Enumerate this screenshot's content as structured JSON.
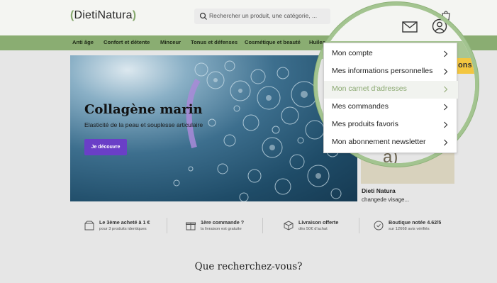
{
  "header": {
    "logo_open": "(",
    "logo_text": "DietiNatura",
    "logo_close": ")",
    "search_placeholder": "Rechercher un produit, une catégorie, ..."
  },
  "nav": {
    "items": [
      "Anti âge",
      "Confort et détente",
      "Minceur",
      "Tonus et défenses",
      "Cosmétique et beauté",
      "Huiles"
    ]
  },
  "hero": {
    "title": "Collagène marin",
    "subtitle": "Elasticité de la peau et souplesse articulaire",
    "button": "Je découvre"
  },
  "side": {
    "name": "Dieti Natura",
    "desc": "changede visage..."
  },
  "features": [
    {
      "title": "Le 3ème acheté à 1 €",
      "sub": "pour 3 produits identiques",
      "icon": "box-icon"
    },
    {
      "title": "1ère commande ?",
      "sub": "la livraison est gratuite",
      "icon": "gift-icon"
    },
    {
      "title": "Livraison offerte",
      "sub": "dès 50€ d'achat",
      "icon": "package-icon"
    },
    {
      "title": "Boutique notée 4.62/5",
      "sub": "sur 12668 avis vérifiés",
      "icon": "badge-icon"
    }
  ],
  "question": "Que recherchez-vous?",
  "zoom": {
    "banner_text": "ons",
    "account_menu": [
      {
        "label": "Mon compte"
      },
      {
        "label": "Mes informations personnelles"
      },
      {
        "label": "Mon carnet d'adresses"
      },
      {
        "label": "Mes commandes"
      },
      {
        "label": "Mes produits favoris"
      },
      {
        "label": "Mon abonnement newsletter"
      }
    ]
  },
  "colors": {
    "brand_green": "#8aad72",
    "cta_purple": "#6a3fc7",
    "highlight_text": "#8aa870"
  }
}
